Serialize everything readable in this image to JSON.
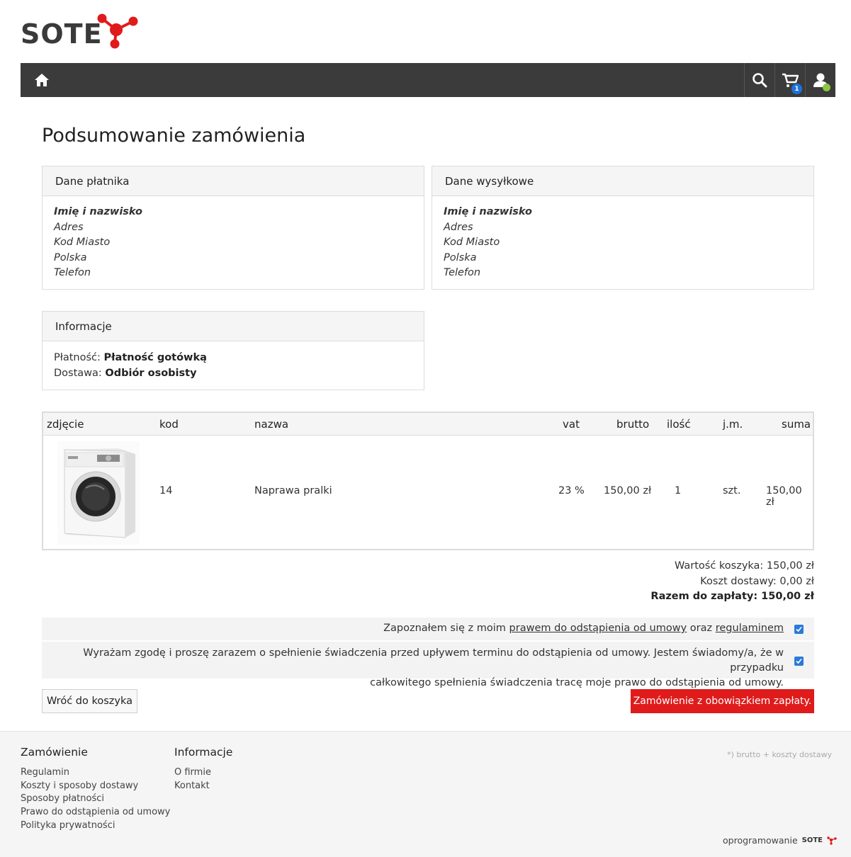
{
  "brand": {
    "name": "SOTE",
    "accent": "#e01b1b"
  },
  "nav": {
    "cart_count": "1"
  },
  "page_title": "Podsumowanie zamówienia",
  "payer": {
    "title": "Dane płatnika",
    "name": "Imię i nazwisko",
    "address": "Adres",
    "city": "Kod Miasto",
    "country": "Polska",
    "phone": "Telefon"
  },
  "shipping": {
    "title": "Dane wysyłkowe",
    "name": "Imię i nazwisko",
    "address": "Adres",
    "city": "Kod Miasto",
    "country": "Polska",
    "phone": "Telefon"
  },
  "info": {
    "title": "Informacje",
    "payment_label": "Płatność:",
    "payment_value": "Płatność gotówką",
    "delivery_label": "Dostawa:",
    "delivery_value": "Odbiór osobisty"
  },
  "table": {
    "headers": {
      "photo": "zdjęcie",
      "code": "kod",
      "name": "nazwa",
      "vat": "vat",
      "gross": "brutto",
      "qty": "ilość",
      "unit": "j.m.",
      "sum": "suma"
    },
    "rows": [
      {
        "code": "14",
        "name": "Naprawa pralki",
        "vat": "23 %",
        "gross": "150,00 zł",
        "qty": "1",
        "unit": "szt.",
        "sum": "150,00 zł"
      }
    ]
  },
  "totals": {
    "cart_value": "Wartość koszyka: 150,00 zł",
    "shipping_cost": "Koszt dostawy: 0,00 zł",
    "grand_total": "Razem do zapłaty: 150,00 zł"
  },
  "consents": {
    "first_prefix": "Zapoznałem się z moim",
    "first_link1": "prawem do odstąpienia od umowy",
    "first_mid": "oraz",
    "first_link2": "regulaminem",
    "second_line1": "Wyrażam zgodę i proszę zarazem o spełnienie świadczenia przed upływem terminu do odstąpienia od umowy. Jestem świadomy/a, że w przypadku",
    "second_line2": "całkowitego spełnienia świadczenia tracę moje prawo do odstąpienia od umowy."
  },
  "buttons": {
    "back": "Wróć do koszyka",
    "order": "Zamówienie z obowiązkiem zapłaty."
  },
  "footer": {
    "col1_title": "Zamówienie",
    "col1_links": [
      "Regulamin",
      "Koszty i sposoby dostawy",
      "Sposoby płatności",
      "Prawo do odstąpienia od umowy",
      "Polityka prywatności"
    ],
    "col2_title": "Informacje",
    "col2_links": [
      "O firmie",
      "Kontakt"
    ],
    "note": "*) brutto + koszty dostawy",
    "software_label": "oprogramowanie",
    "software_brand": "SOTE"
  }
}
